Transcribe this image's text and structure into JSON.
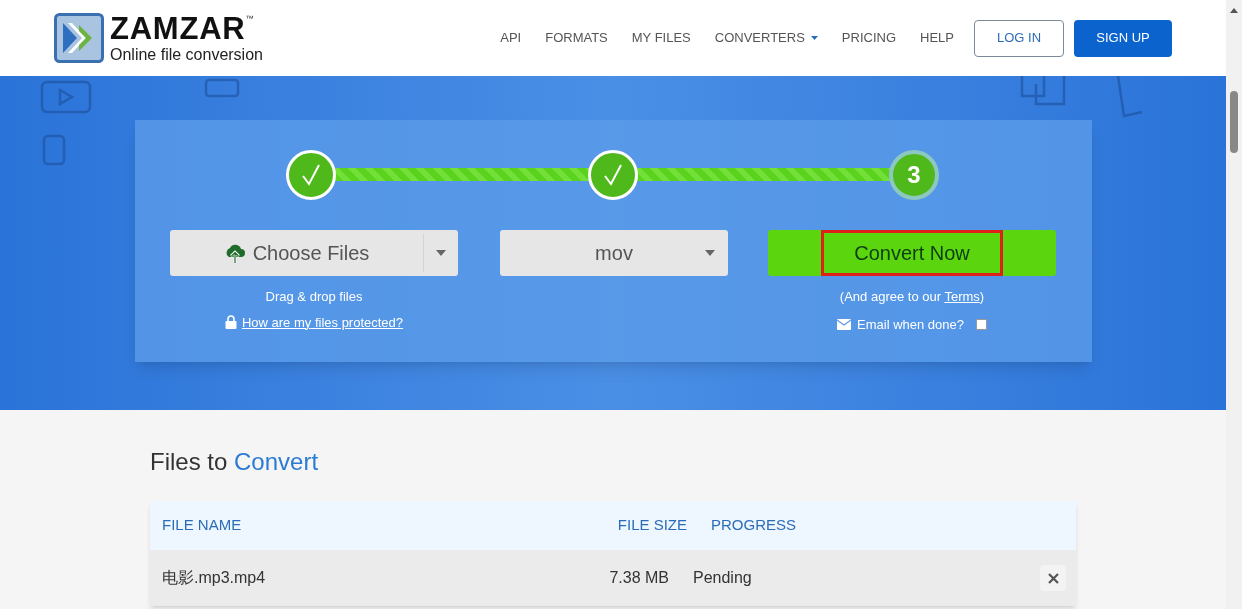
{
  "logo": {
    "name": "ZAMZAR",
    "trademark": "™",
    "tagline": "Online file conversion"
  },
  "nav": [
    {
      "label": "API",
      "has_menu": false
    },
    {
      "label": "FORMATS",
      "has_menu": false
    },
    {
      "label": "MY FILES",
      "has_menu": false
    },
    {
      "label": "CONVERTERS",
      "has_menu": true
    },
    {
      "label": "PRICING",
      "has_menu": false
    },
    {
      "label": "HELP",
      "has_menu": false
    }
  ],
  "auth": [
    {
      "label": "LOG IN",
      "kind": "outline"
    },
    {
      "label": "SIGN UP",
      "kind": "solid"
    }
  ],
  "steps": [
    {
      "done": true
    },
    {
      "done": true
    },
    {
      "done": false,
      "label": "3"
    }
  ],
  "choose_files": {
    "label": "Choose Files",
    "hint": "Drag & drop files",
    "link": "How are my files protected?"
  },
  "format": {
    "value": "mov"
  },
  "convert": {
    "label": "Convert Now",
    "highlighted": true,
    "agree_prefix": "(And agree to our ",
    "terms": "Terms",
    "agree_suffix": ")",
    "email_label": "Email when done?",
    "email_checked": false
  },
  "files": {
    "title_plain": "Files to",
    "title_accent": "Convert",
    "columns": [
      "FILE NAME",
      "FILE SIZE",
      "PROGRESS"
    ],
    "rows": [
      {
        "name": "电影.mp3.mp4",
        "size": "7.38 MB",
        "progress": "Pending"
      }
    ]
  }
}
